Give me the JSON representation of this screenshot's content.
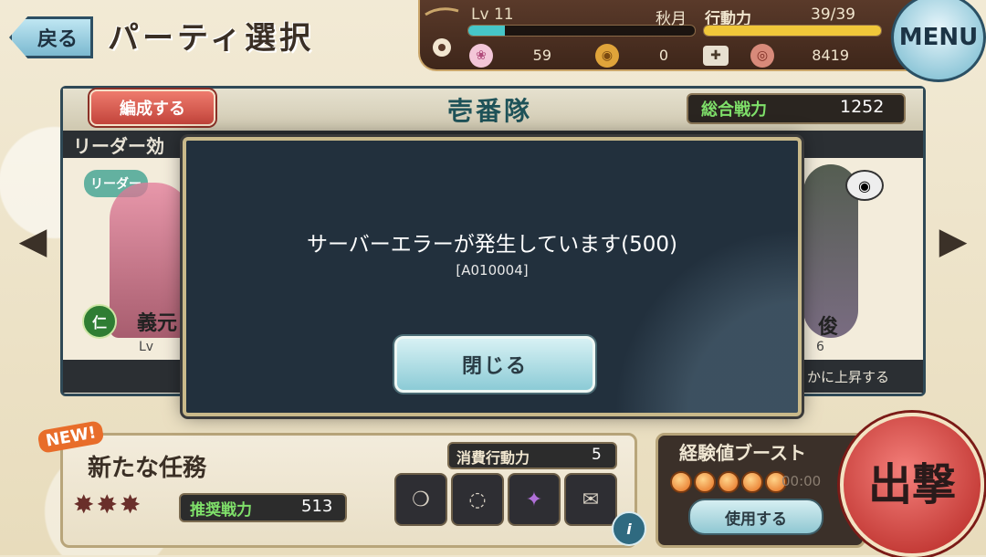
{
  "header": {
    "back_label": "戻る",
    "title": "パーティ選択",
    "menu_label": "MENU"
  },
  "status": {
    "lv_label": "Lv",
    "level": "11",
    "exp_progress": 0.16,
    "player_name": "秋月",
    "ap_label": "行動力",
    "ap_value": "39/39",
    "ap_progress": 1.0,
    "currencies": [
      {
        "icon": "flower-gem-icon",
        "value": "59"
      },
      {
        "icon": "gold-coin-icon",
        "value": "0"
      },
      {
        "icon": "bronze-coin-icon",
        "value": "8419"
      }
    ],
    "plus_label": "✚"
  },
  "party": {
    "edit_label": "編成する",
    "name": "壱番隊",
    "power_label": "総合戦力",
    "power_value": "1252",
    "leader_effect_label": "リーダー効",
    "leader_tag": "リーダー",
    "left_char": {
      "attr": "仁",
      "name": "義元",
      "lv": "Lv"
    },
    "right_char": {
      "name": "俊",
      "lv": "6"
    },
    "effect_text": "かに上昇する"
  },
  "modal": {
    "message": "サーバーエラーが発生しています(500)",
    "code": "[A010004]",
    "close_label": "閉じる"
  },
  "task": {
    "new_badge": "NEW!",
    "title": "新たな任務",
    "difficulty_stars": "✸✸✸",
    "recommended_label": "推奨戦力",
    "recommended_value": "513",
    "cost_label": "消費行動力",
    "cost_value": "5",
    "info_label": "i"
  },
  "boost": {
    "label": "経験値ブースト",
    "charges": 5,
    "time": "00:00",
    "use_label": "使用する"
  },
  "sortie_label": "出撃",
  "colors": {
    "teal": "#46c6c8",
    "gold": "#f0c73a",
    "red": "#c2443b",
    "green": "#7fe06a"
  }
}
